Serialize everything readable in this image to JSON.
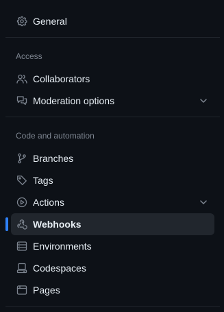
{
  "general": {
    "label": "General",
    "icon": "gear-icon"
  },
  "access": {
    "heading": "Access",
    "items": [
      {
        "label": "Collaborators",
        "icon": "people-icon"
      },
      {
        "label": "Moderation options",
        "icon": "comment-discussion-icon",
        "expandable": true
      }
    ]
  },
  "code_automation": {
    "heading": "Code and automation",
    "items": [
      {
        "label": "Branches",
        "icon": "git-branch-icon"
      },
      {
        "label": "Tags",
        "icon": "tag-icon"
      },
      {
        "label": "Actions",
        "icon": "play-icon",
        "expandable": true
      },
      {
        "label": "Webhooks",
        "icon": "webhook-icon",
        "active": true
      },
      {
        "label": "Environments",
        "icon": "server-icon"
      },
      {
        "label": "Codespaces",
        "icon": "codespaces-icon"
      },
      {
        "label": "Pages",
        "icon": "browser-icon"
      }
    ]
  },
  "colors": {
    "background": "#0d1117",
    "text": "#e6edf3",
    "muted": "#7d8590",
    "active_bg": "#21262d",
    "accent": "#2f81f7"
  }
}
